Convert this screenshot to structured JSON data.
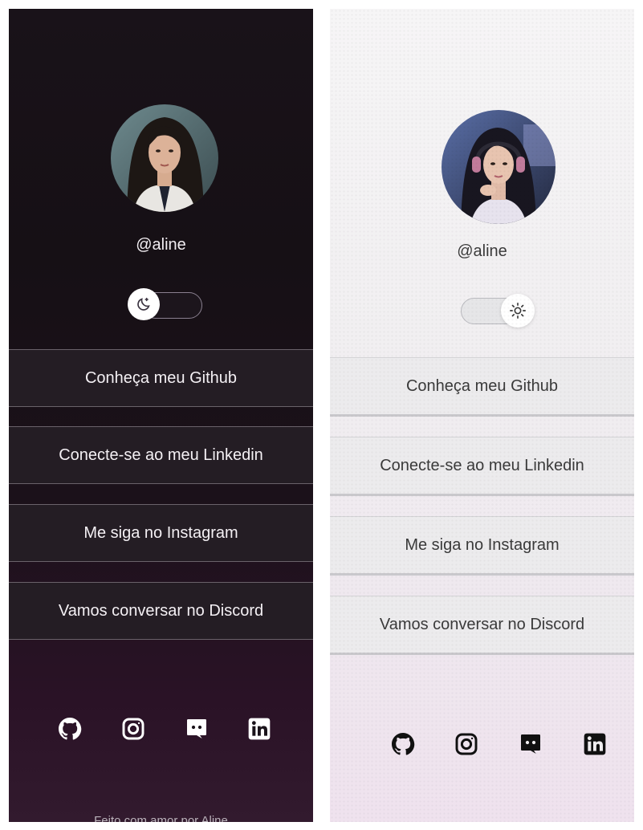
{
  "dark": {
    "username": "@aline",
    "theme_icon": "moon-icon",
    "links": [
      {
        "label": "Conheça meu Github"
      },
      {
        "label": "Conecte-se ao meu Linkedin"
      },
      {
        "label": "Me siga no Instagram"
      },
      {
        "label": "Vamos conversar no Discord"
      }
    ],
    "social_icons": [
      "github-icon",
      "instagram-icon",
      "discord-icon",
      "linkedin-icon"
    ],
    "footer": "Feito com amor por Aline"
  },
  "light": {
    "username": "@aline",
    "theme_icon": "sun-icon",
    "links": [
      {
        "label": "Conheça meu Github"
      },
      {
        "label": "Conecte-se ao meu Linkedin"
      },
      {
        "label": "Me siga no Instagram"
      },
      {
        "label": "Vamos conversar no Discord"
      }
    ],
    "social_icons": [
      "github-icon",
      "instagram-icon",
      "discord-icon",
      "linkedin-icon"
    ]
  },
  "colors": {
    "dark_bg": "#191219",
    "dark_button": "#241d24",
    "light_bg": "#f4f2f4",
    "light_button": "#ecebed"
  }
}
